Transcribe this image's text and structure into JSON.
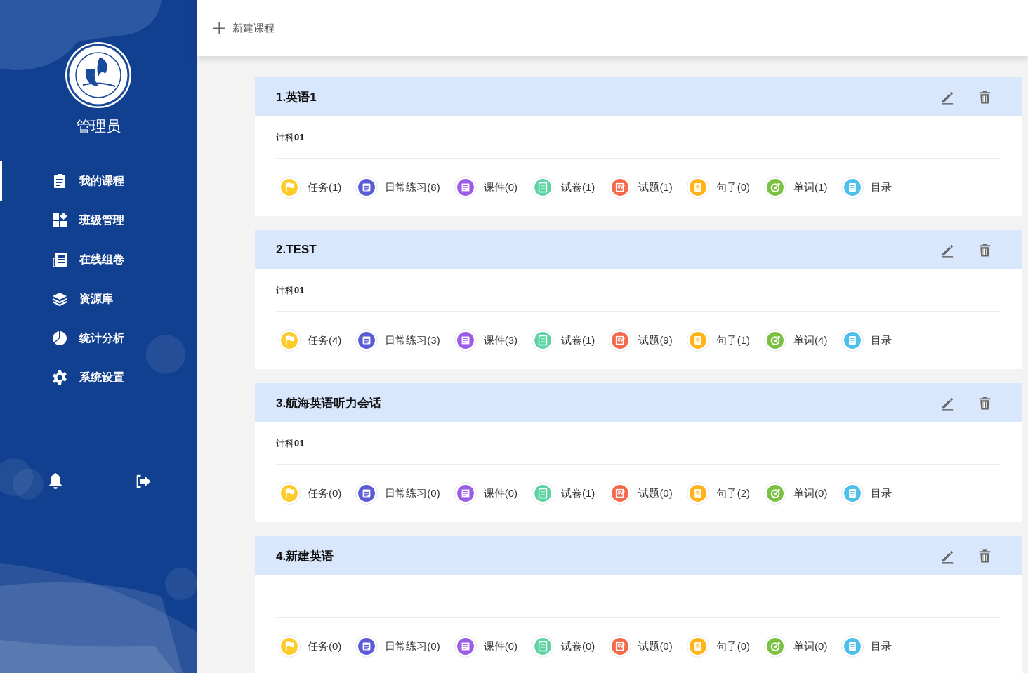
{
  "sidebar": {
    "user_name": "管理员",
    "nav_items": [
      {
        "kind": "course",
        "label": "我的课程",
        "selected": true
      },
      {
        "kind": "class",
        "label": "班级管理",
        "selected": false
      },
      {
        "kind": "paper",
        "label": "在线组卷",
        "selected": false
      },
      {
        "kind": "library",
        "label": "资源库",
        "selected": false
      },
      {
        "kind": "stats",
        "label": "统计分析",
        "selected": false
      },
      {
        "kind": "settings",
        "label": "系统设置",
        "selected": false
      }
    ]
  },
  "toolbar": {
    "new_course_button": "新建课程"
  },
  "courses": [
    {
      "title": "1.英语1",
      "class_name": "计科**01**",
      "links": [
        {
          "kind": "task",
          "label": "任务(1)",
          "color": "#fccb2c"
        },
        {
          "kind": "practice",
          "label": "日常练习(8)",
          "color": "#5b5bd6"
        },
        {
          "kind": "courseware",
          "label": "课件(0)",
          "color": "#9b5de5"
        },
        {
          "kind": "paper",
          "label": "试卷(1)",
          "color": "#5fd3a4"
        },
        {
          "kind": "question",
          "label": "试题(1)",
          "color": "#f5694b"
        },
        {
          "kind": "sentence",
          "label": "句子(0)",
          "color": "#ffb31a"
        },
        {
          "kind": "word",
          "label": "单词(1)",
          "color": "#7ac142"
        },
        {
          "kind": "catalog",
          "label": "目录",
          "color": "#4dc0ea"
        }
      ]
    },
    {
      "title": "2.TEST",
      "class_name": "计科**01**",
      "links": [
        {
          "kind": "task",
          "label": "任务(4)",
          "color": "#fccb2c"
        },
        {
          "kind": "practice",
          "label": "日常练习(3)",
          "color": "#5b5bd6"
        },
        {
          "kind": "courseware",
          "label": "课件(3)",
          "color": "#9b5de5"
        },
        {
          "kind": "paper",
          "label": "试卷(1)",
          "color": "#5fd3a4"
        },
        {
          "kind": "question",
          "label": "试题(9)",
          "color": "#f5694b"
        },
        {
          "kind": "sentence",
          "label": "句子(1)",
          "color": "#ffb31a"
        },
        {
          "kind": "word",
          "label": "单词(4)",
          "color": "#7ac142"
        },
        {
          "kind": "catalog",
          "label": "目录",
          "color": "#4dc0ea"
        }
      ]
    },
    {
      "title": "3.航海英语听力会话",
      "class_name": "计科**01**",
      "links": [
        {
          "kind": "task",
          "label": "任务(0)",
          "color": "#fccb2c"
        },
        {
          "kind": "practice",
          "label": "日常练习(0)",
          "color": "#5b5bd6"
        },
        {
          "kind": "courseware",
          "label": "课件(0)",
          "color": "#9b5de5"
        },
        {
          "kind": "paper",
          "label": "试卷(1)",
          "color": "#5fd3a4"
        },
        {
          "kind": "question",
          "label": "试题(0)",
          "color": "#f5694b"
        },
        {
          "kind": "sentence",
          "label": "句子(2)",
          "color": "#ffb31a"
        },
        {
          "kind": "word",
          "label": "单词(0)",
          "color": "#7ac142"
        },
        {
          "kind": "catalog",
          "label": "目录",
          "color": "#4dc0ea"
        }
      ]
    },
    {
      "title": "4.新建英语",
      "links": [
        {
          "kind": "task",
          "label": "任务(0)",
          "color": "#fccb2c"
        },
        {
          "kind": "practice",
          "label": "日常练习(0)",
          "color": "#5b5bd6"
        },
        {
          "kind": "courseware",
          "label": "课件(0)",
          "color": "#9b5de5"
        },
        {
          "kind": "paper",
          "label": "试卷(0)",
          "color": "#5fd3a4"
        },
        {
          "kind": "question",
          "label": "试题(0)",
          "color": "#f5694b"
        },
        {
          "kind": "sentence",
          "label": "句子(0)",
          "color": "#ffb31a"
        },
        {
          "kind": "word",
          "label": "单词(0)",
          "color": "#7ac142"
        },
        {
          "kind": "catalog",
          "label": "目录",
          "color": "#4dc0ea"
        }
      ]
    }
  ]
}
